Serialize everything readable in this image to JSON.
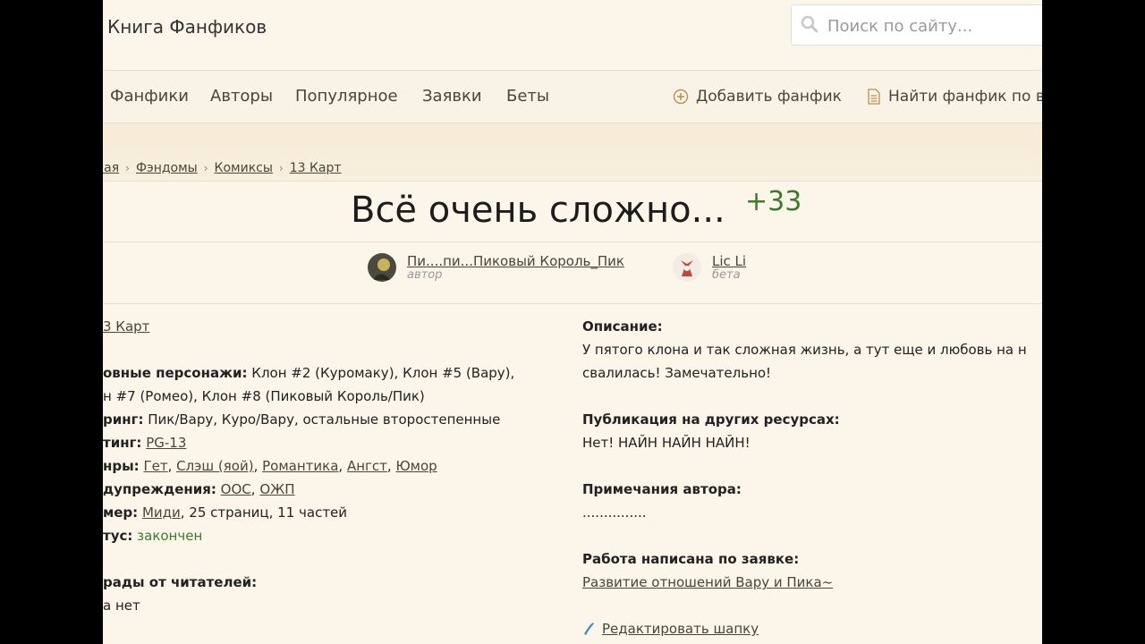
{
  "header": {
    "site_title": "Книга Фанфиков",
    "search_placeholder": "Поиск по сайту..."
  },
  "nav": {
    "items": [
      "Фанфики",
      "Авторы",
      "Популярное",
      "Заявки",
      "Беты"
    ],
    "add_fic": "Добавить фанфик",
    "find_fic": "Найти фанфик по в"
  },
  "breadcrumb": [
    "ная",
    "Фэндомы",
    "Комиксы",
    "13 Карт"
  ],
  "fic": {
    "title": "Всё очень сложно...",
    "rating": "+33"
  },
  "author": {
    "name": "Пи....пи...Пиковый Король_Пик",
    "role": "автор"
  },
  "beta": {
    "name": "Lic Li",
    "role": "бета"
  },
  "details": {
    "fandom": "3 Карт",
    "main_chars_label": "овные персонажи:",
    "main_chars_1": "Клон #2 (Куромаку), Клон #5 (Вару),",
    "main_chars_2": "н #7 (Ромео), Клон #8 (Пиковый Король/Пик)",
    "pairing_label": "ринг:",
    "pairing": "Пик/Вару, Куро/Вару, остальные второстепенные",
    "rating_label": "тинг:",
    "rating": "PG-13",
    "genres_label": "нры:",
    "genres": [
      "Гет",
      "Слэш (яой)",
      "Романтика",
      "Ангст",
      "Юмор"
    ],
    "warnings_label": "дупреждения:",
    "warnings": [
      "ООС",
      "ОЖП"
    ],
    "size_label": "мер:",
    "size_link": "Миди",
    "size_rest": ", 25 страниц, 11 частей",
    "status_label": "тус:",
    "status": "закончен",
    "awards_label": "рады от читателей:",
    "awards": "а нет"
  },
  "right": {
    "desc_label": "Описание:",
    "desc_1": "У пятого клона и так сложная жизнь, а тут еще и любовь на н",
    "desc_2": "свалилась! Замечательно!",
    "pub_label": "Публикация на других ресурсах:",
    "pub": "Нет! НАЙН НАЙН НАЙН!",
    "notes_label": "Примечания автора:",
    "notes": "...............",
    "request_label": "Работа написана по заявке:",
    "request_link": "Развитие отношений Вару и Пика~",
    "edit_link": "Редактировать шапку"
  },
  "colors": {
    "background": "#fbf5ea",
    "accent_green": "#3d7a2e",
    "link": "#4a4636"
  }
}
